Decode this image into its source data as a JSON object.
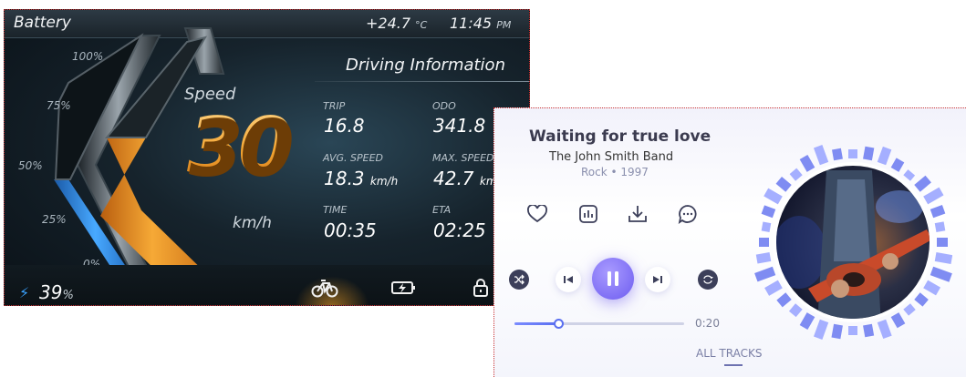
{
  "dashboard": {
    "battery_title": "Battery",
    "temperature_value": "+24.7",
    "temperature_unit": "°C",
    "time_value": "11:45",
    "time_ampm": "PM",
    "battery_scale": [
      "100%",
      "75%",
      "50%",
      "25%",
      "0%"
    ],
    "speed_label": "Speed",
    "speed_value": "30",
    "speed_unit": "km/h",
    "info_title": "Driving Information",
    "stats": [
      {
        "label": "TRIP",
        "value": "16.8",
        "unit": ""
      },
      {
        "label": "ODO",
        "value": "341.8",
        "unit": ""
      },
      {
        "label": "AVG. SPEED",
        "value": "18.3",
        "unit": "km/h"
      },
      {
        "label": "MAX. SPEED",
        "value": "42.7",
        "unit": "km/h"
      },
      {
        "label": "TIME",
        "value": "00:35",
        "unit": ""
      },
      {
        "label": "ETA",
        "value": "02:25",
        "unit": ""
      }
    ],
    "battery_level_value": "39",
    "battery_level_unit": "%",
    "bottom_icons": [
      "bicycle-icon",
      "charging-battery-icon",
      "lock-icon"
    ],
    "accent_color": "#f5a12f",
    "battery_color": "#2f8ff0"
  },
  "player": {
    "song_title": "Waiting for true love",
    "band": "The John Smith Band",
    "meta": "Rock • 1997",
    "action_icons": [
      "heart-icon",
      "equalizer-icon",
      "download-icon",
      "comment-icon"
    ],
    "controls": [
      "shuffle-icon",
      "previous-icon",
      "pause-icon",
      "next-icon",
      "repeat-icon"
    ],
    "progress_fraction": 0.26,
    "time": "0:20",
    "all_tracks_label": "ALL TRACKS",
    "accent_color": "#6d5cf0"
  }
}
